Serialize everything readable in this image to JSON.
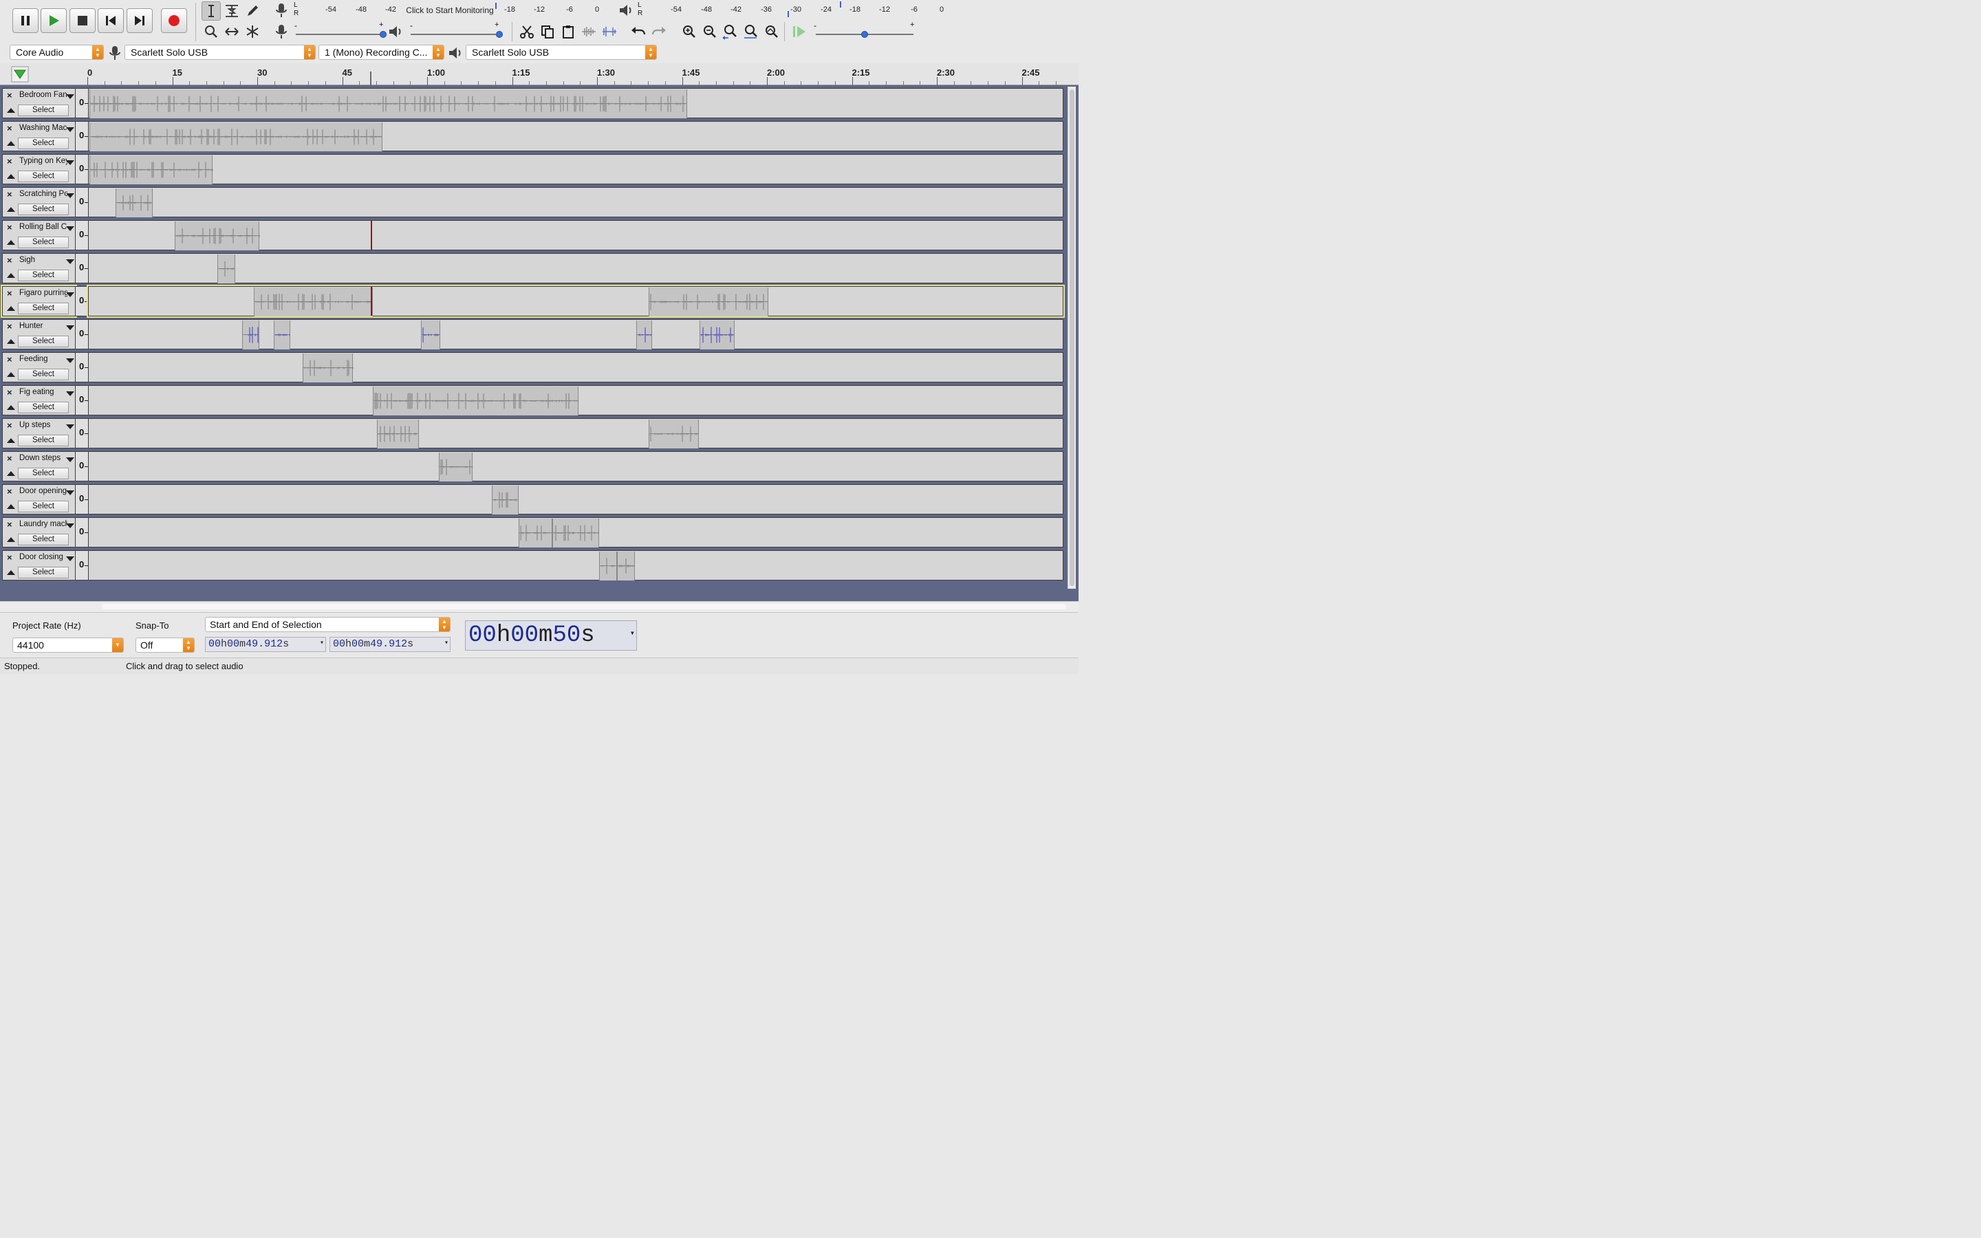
{
  "toolbar": {
    "transport": [
      {
        "name": "pause-button",
        "icon": "pause-icon"
      },
      {
        "name": "play-button",
        "icon": "play-icon"
      },
      {
        "name": "stop-button",
        "icon": "stop-icon"
      },
      {
        "name": "skip-to-start-button",
        "icon": "skip-start-icon"
      },
      {
        "name": "skip-to-end-button",
        "icon": "skip-end-icon"
      },
      {
        "name": "record-button",
        "icon": "record-icon"
      }
    ],
    "record_meter": {
      "channels": [
        "L",
        "R"
      ],
      "scale": [
        "-54",
        "-48",
        "-42",
        "-18",
        "-12",
        "-6",
        "0"
      ],
      "prompt": "Click to Start Monitoring"
    },
    "play_meter": {
      "channels": [
        "L",
        "R"
      ],
      "scale": [
        "-54",
        "-48",
        "-42",
        "-36",
        "-30",
        "-24",
        "-18",
        "-12",
        "-6",
        "0"
      ]
    },
    "recording_volume_level": 1.0,
    "playback_volume_level": 1.0,
    "play_at_speed_level": 0.5,
    "slider_marks": {
      "minus": "-",
      "plus": "+"
    }
  },
  "devices": {
    "host": "Core Audio",
    "recording_device": "Scarlett Solo USB",
    "recording_channels": "1 (Mono) Recording C...",
    "playback_device": "Scarlett Solo USB"
  },
  "ruler": {
    "labels": [
      "0",
      "15",
      "30",
      "45",
      "1:00",
      "1:15",
      "1:30",
      "1:45",
      "2:00",
      "2:15",
      "2:30",
      "2:45"
    ]
  },
  "tracks": [
    {
      "name": "Bedroom Fan",
      "select": "Select",
      "zero": "0",
      "clips": [
        [
          0,
          105.5
        ]
      ]
    },
    {
      "name": "Washing Mac",
      "select": "Select",
      "zero": "0",
      "clips": [
        [
          0,
          51.8
        ]
      ]
    },
    {
      "name": "Typing on Key",
      "select": "Select",
      "zero": "0",
      "clips": [
        [
          0,
          21.8
        ]
      ]
    },
    {
      "name": "Scratching Po",
      "select": "Select",
      "zero": "0",
      "clips": [
        [
          4.6,
          11.2
        ]
      ]
    },
    {
      "name": "Rolling Ball C",
      "select": "Select",
      "zero": "0",
      "clips": [
        [
          15,
          30
        ]
      ]
    },
    {
      "name": "Sigh",
      "select": "Select",
      "zero": "0",
      "clips": [
        [
          22.6,
          25.8
        ]
      ]
    },
    {
      "name": "Figaro purring",
      "select": "Select",
      "zero": "0",
      "clips": [
        [
          29,
          50
        ],
        [
          98.8,
          119.9
        ]
      ]
    },
    {
      "name": "Hunter",
      "select": "Select",
      "zero": "0",
      "clips": [
        [
          27,
          30
        ],
        [
          32.6,
          35.5
        ],
        [
          58.5,
          61.9
        ],
        [
          96.6,
          99.3
        ],
        [
          107.7,
          113.9
        ]
      ]
    },
    {
      "name": "Feeding",
      "select": "Select",
      "zero": "0",
      "clips": [
        [
          37.6,
          46.5
        ]
      ]
    },
    {
      "name": "Fig eating",
      "select": "Select",
      "zero": "0",
      "clips": [
        [
          50,
          86.4
        ]
      ]
    },
    {
      "name": "Up steps",
      "select": "Select",
      "zero": "0",
      "clips": [
        [
          50.8,
          58.2
        ],
        [
          98.8,
          107.6
        ]
      ]
    },
    {
      "name": "Down steps",
      "select": "Select",
      "zero": "0",
      "clips": [
        [
          61.7,
          67.7
        ]
      ]
    },
    {
      "name": "Door opening",
      "select": "Select",
      "zero": "0",
      "clips": [
        [
          71.1,
          75.8
        ]
      ]
    },
    {
      "name": "Laundry mach",
      "select": "Select",
      "zero": "0",
      "clips": [
        [
          75.8,
          81.8
        ],
        [
          81.8,
          90
        ]
      ]
    },
    {
      "name": "Door closing",
      "select": "Select",
      "zero": "0",
      "clips": [
        [
          90,
          93.2
        ],
        [
          93.2,
          96.3
        ]
      ]
    }
  ],
  "focused_track": "Figaro purring",
  "cursor_time_s": 49.912,
  "selection_toolbar": {
    "project_rate_label": "Project Rate (Hz)",
    "project_rate_value": "44100",
    "snap_to_label": "Snap-To",
    "snap_to_value": "Off",
    "selection_mode": "Start and End of Selection",
    "start_time": {
      "h": "00",
      "m": "00",
      "s": "49.912"
    },
    "end_time": {
      "h": "00",
      "m": "00",
      "s": "49.912"
    },
    "units": {
      "h": "h",
      "m": "m",
      "s": "s"
    },
    "audio_position": {
      "h": "00",
      "m": "00",
      "s": "50"
    }
  },
  "status": {
    "state": "Stopped.",
    "hint": "Click and drag to select audio"
  },
  "colors": {
    "accent": "#e97f12",
    "track_area": "#5f6786",
    "clip": "#c4c4c4",
    "hunter_wave": "#3a3ad0",
    "time_text": "#1b2b8f",
    "focus": "#e8e38a"
  }
}
